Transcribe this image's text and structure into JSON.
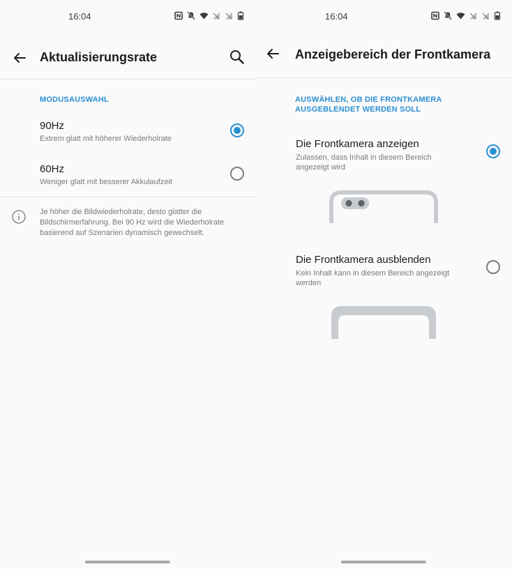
{
  "left": {
    "status_time": "16:04",
    "title": "Aktualisierungsrate",
    "section_header": "MODUSAUSWAHL",
    "options": [
      {
        "title": "90Hz",
        "subtitle": "Extrem glatt mit höherer Wiederholrate",
        "selected": true
      },
      {
        "title": "60Hz",
        "subtitle": "Weniger glatt mit besserer Akkulaufzeit",
        "selected": false
      }
    ],
    "info_text": "Je höher die Bildwiederholrate, desto glatter die Bildschirmerfahrung. Bei 90 Hz wird die Wiederholrate basierend auf Szenarien dynamisch gewechselt."
  },
  "right": {
    "status_time": "16:04",
    "title": "Anzeigebereich der Frontkamera",
    "section_header": "AUSWÄHLEN, OB DIE FRONTKAMERA AUSGEBLENDET WERDEN SOLL",
    "options": [
      {
        "title": "Die Frontkamera anzeigen",
        "subtitle": "Zulassen, dass Inhalt in diesem Bereich angezeigt wird",
        "selected": true
      },
      {
        "title": "Die Frontkamera ausblenden",
        "subtitle": "Kein Inhalt kann in diesem Bereich angezeigt werden",
        "selected": false
      }
    ]
  },
  "colors": {
    "accent": "#2b8fd3",
    "background": "#fafafa",
    "phone_frame": "#c8ccd0"
  },
  "icons": [
    "back-arrow-icon",
    "search-icon",
    "info-icon",
    "nfc-icon",
    "mute-icon",
    "wifi-icon",
    "no-signal-icon",
    "battery-icon"
  ]
}
